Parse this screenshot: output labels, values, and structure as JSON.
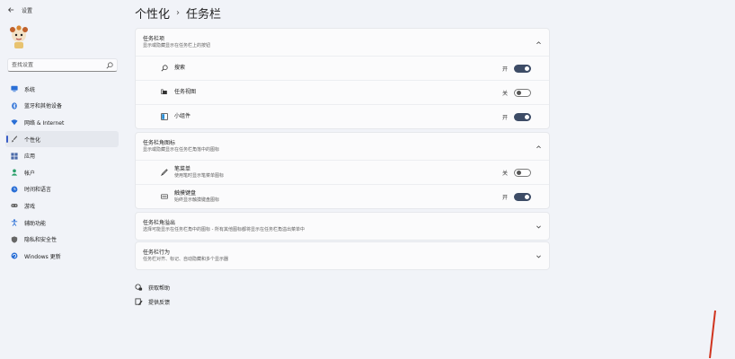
{
  "app": {
    "title": "设置"
  },
  "search": {
    "placeholder": "查找设置"
  },
  "sidebar": {
    "items": [
      {
        "label": "系统",
        "icon": "monitor-icon",
        "color": "#2a6fd6"
      },
      {
        "label": "蓝牙和其他设备",
        "icon": "bluetooth-icon",
        "color": "#2a6fd6"
      },
      {
        "label": "网络 & Internet",
        "icon": "wifi-icon",
        "color": "#2a6fd6"
      },
      {
        "label": "个性化",
        "icon": "brush-icon",
        "color": "#555555",
        "active": true
      },
      {
        "label": "应用",
        "icon": "apps-icon",
        "color": "#4a6aa8"
      },
      {
        "label": "帐户",
        "icon": "person-icon",
        "color": "#2aa06a"
      },
      {
        "label": "时间和语言",
        "icon": "globe-clock-icon",
        "color": "#2a6fd6"
      },
      {
        "label": "游戏",
        "icon": "gamepad-icon",
        "color": "#555555"
      },
      {
        "label": "辅助功能",
        "icon": "accessibility-icon",
        "color": "#2a6fd6"
      },
      {
        "label": "隐私和安全性",
        "icon": "shield-icon",
        "color": "#666666"
      },
      {
        "label": "Windows 更新",
        "icon": "update-icon",
        "color": "#2a6fd6"
      }
    ]
  },
  "header": {
    "parent": "个性化",
    "separator": "›",
    "current": "任务栏"
  },
  "sections": {
    "taskbar_items": {
      "title": "任务栏项",
      "subtitle": "显示或隐藏显示在任务栏上的按钮",
      "rows": [
        {
          "label": "搜索",
          "icon": "search-icon",
          "state": "开",
          "on": true
        },
        {
          "label": "任务视图",
          "icon": "task-view-icon",
          "state": "关",
          "on": false
        },
        {
          "label": "小组件",
          "icon": "widgets-icon",
          "state": "开",
          "on": true
        }
      ]
    },
    "corner_icons": {
      "title": "任务栏角图标",
      "subtitle": "显示或隐藏显示在任务栏角落中的图标",
      "rows": [
        {
          "label": "笔菜单",
          "sub": "使用笔时显示笔菜单图标",
          "icon": "pen-icon",
          "state": "关",
          "on": false
        },
        {
          "label": "触摸键盘",
          "sub": "始终显示触摸键盘图标",
          "icon": "keyboard-icon",
          "state": "开",
          "on": true
        }
      ]
    },
    "corner_overflow": {
      "title": "任务栏角溢出",
      "subtitle": "选择可能显示在任务栏角中的图标 - 所有其他图标都将显示在任务栏角溢出菜单中"
    },
    "behaviors": {
      "title": "任务栏行为",
      "subtitle": "任务栏对齐、标记、自动隐藏和多个显示器"
    }
  },
  "links": {
    "help": "获取帮助",
    "feedback": "提供反馈"
  },
  "colors": {
    "accent": "#3a5dc7",
    "toggle_on": "#3d4c66"
  }
}
